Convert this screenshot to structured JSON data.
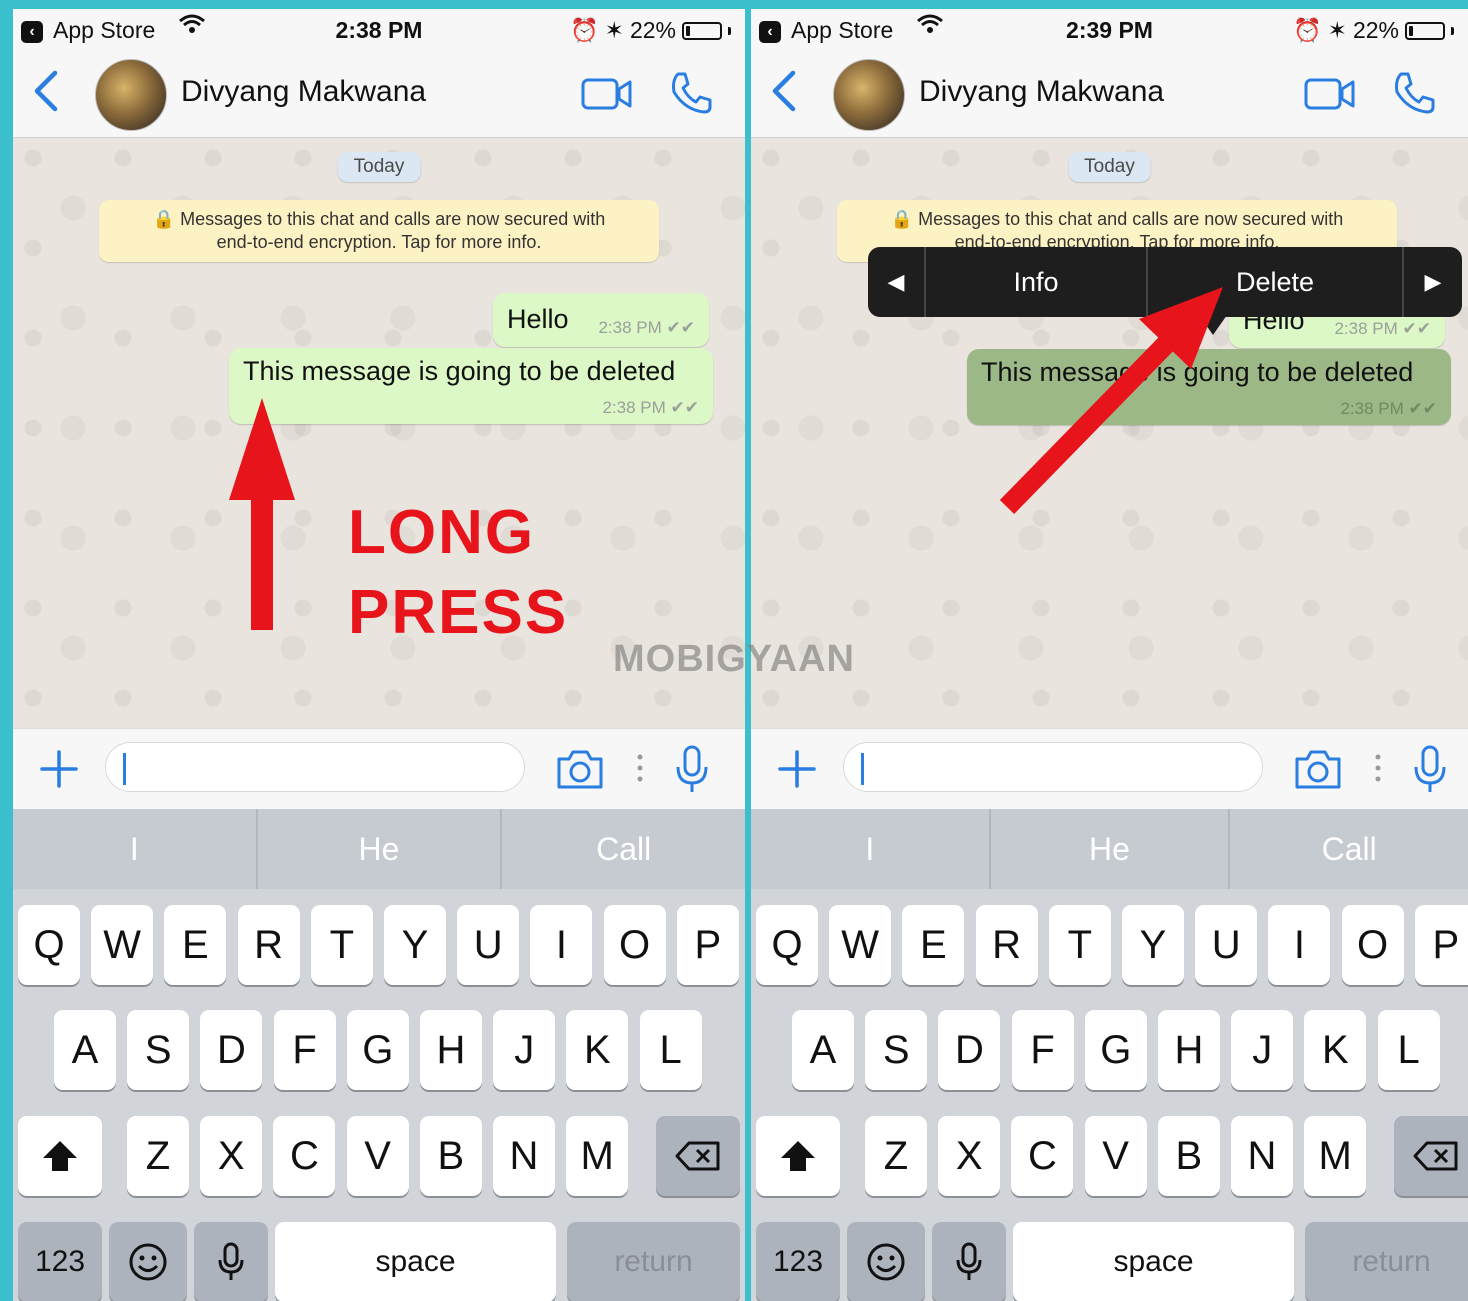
{
  "left": {
    "status": {
      "carrier": "App Store",
      "time": "2:38 PM",
      "battery": "22%",
      "battery_level": 0.22
    },
    "header": {
      "contact_name": "Divyang Makwana"
    },
    "chat": {
      "date_label": "Today",
      "encryption_line1": "🔒 Messages to this chat and calls are now secured with",
      "encryption_line2": "end-to-end encryption. Tap for more info.",
      "messages": [
        {
          "text": "Hello",
          "time": "2:38 PM ✔✔"
        },
        {
          "text": "This message is going to be deleted",
          "time": "2:38 PM ✔✔"
        }
      ]
    },
    "annotation": {
      "line1": "LONG",
      "line2": "PRESS"
    },
    "input": {
      "placeholder": ""
    },
    "suggestions": [
      "I",
      "He",
      "Call"
    ]
  },
  "right": {
    "status": {
      "carrier": "App Store",
      "time": "2:39 PM",
      "battery": "22%",
      "battery_level": 0.22
    },
    "header": {
      "contact_name": "Divyang Makwana"
    },
    "chat": {
      "date_label": "Today",
      "encryption_line1": "🔒 Messages to this chat and calls are now secured with",
      "encryption_line2": "end-to-end encryption. Tap for more info.",
      "messages": [
        {
          "text": "Hello",
          "time": "2:38 PM ✔✔"
        },
        {
          "text": "This message is going to be deleted",
          "time": "2:38 PM ✔✔"
        }
      ]
    },
    "context_menu": {
      "prev": "◀",
      "info": "Info",
      "delete": "Delete",
      "next": "▶"
    },
    "input": {
      "placeholder": ""
    },
    "suggestions": [
      "I",
      "He",
      "Call"
    ]
  },
  "keyboard": {
    "row1": [
      "Q",
      "W",
      "E",
      "R",
      "T",
      "Y",
      "U",
      "I",
      "O",
      "P"
    ],
    "row2": [
      "A",
      "S",
      "D",
      "F",
      "G",
      "H",
      "J",
      "K",
      "L"
    ],
    "row3": [
      "Z",
      "X",
      "C",
      "V",
      "B",
      "N",
      "M"
    ],
    "numbers_key": "123",
    "space_key": "space",
    "return_key": "return"
  },
  "watermark": "MOBIGYAAN",
  "colors": {
    "accent": "#2a7de1",
    "bubble": "#dcf8c6",
    "annotation": "#e8141c",
    "frame": "#3bbfcc"
  },
  "icons": [
    "back-icon",
    "video-call-icon",
    "phone-icon",
    "plus-icon",
    "camera-icon",
    "microphone-icon",
    "shift-icon",
    "backspace-icon",
    "emoji-icon",
    "wifi-icon",
    "bluetooth-icon",
    "alarm-icon",
    "lock-icon"
  ]
}
